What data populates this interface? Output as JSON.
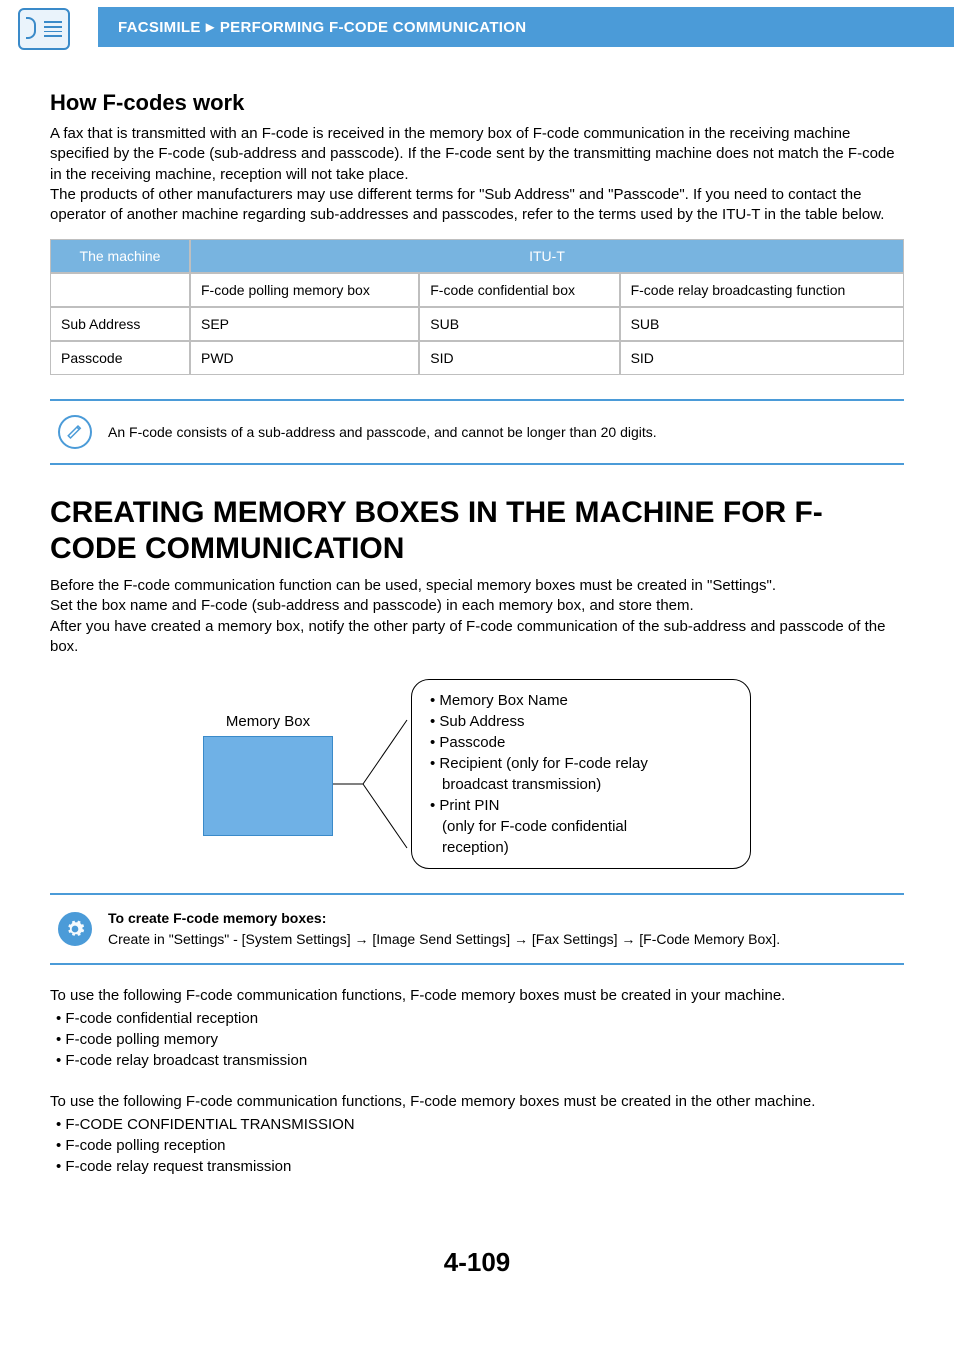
{
  "breadcrumb": {
    "section": "FACSIMILE",
    "sep": "►",
    "page": "PERFORMING F-CODE COMMUNICATION"
  },
  "subhead": "How F-codes work",
  "intro_p1": "A fax that is transmitted with an F-code is received in the memory box of F-code communication in the receiving machine specified by the F-code (sub-address and passcode). If the F-code sent by the transmitting machine does not match the F-code in the receiving machine, reception will not take place.",
  "intro_p2": "The products of other manufacturers may use different terms for \"Sub Address\" and \"Passcode\". If you need to contact the operator of another machine regarding sub-addresses and passcodes, refer to the terms used by the ITU-T in the table below.",
  "table": {
    "head_machine": "The machine",
    "head_itu": "ITU-T",
    "cols": [
      "F-code polling memory box",
      "F-code confidential box",
      "F-code relay broadcasting function"
    ],
    "rows": [
      {
        "label": "Sub Address",
        "c1": "SEP",
        "c2": "SUB",
        "c3": "SUB"
      },
      {
        "label": "Passcode",
        "c1": "PWD",
        "c2": "SID",
        "c3": "SID"
      }
    ]
  },
  "note1": "An F-code consists of a sub-address and passcode, and cannot be longer than 20 digits.",
  "mainhead": "CREATING MEMORY BOXES IN THE MACHINE FOR F-CODE COMMUNICATION",
  "main_p1": "Before the F-code communication function can be used, special memory boxes must be created in \"Settings\".",
  "main_p2": "Set the box name and F-code (sub-address and passcode) in each memory box, and store them.",
  "main_p3": "After you have created a memory box, notify the other party of F-code communication of the sub-address and passcode of the box.",
  "diagram": {
    "mem_label": "Memory Box",
    "items": [
      "Memory Box Name",
      "Sub Address",
      "Passcode",
      "Recipient (only for F-code relay",
      "broadcast transmission)",
      "Print PIN",
      "(only for F-code confidential",
      "reception)"
    ],
    "bullet_idx": [
      0,
      1,
      2,
      3,
      5
    ],
    "indent_idx": [
      4,
      6,
      7
    ]
  },
  "settings_note": {
    "title": "To create F-code memory boxes:",
    "body": "Create in \"Settings\" - [System Settings] → [Image Send Settings] → [Fax Settings] → [F-Code Memory Box]."
  },
  "funcs_your": {
    "lead": "To use the following F-code communication functions, F-code memory boxes must be created in your machine.",
    "items": [
      "F-code confidential reception",
      "F-code polling memory",
      "F-code relay broadcast transmission"
    ]
  },
  "funcs_other": {
    "lead": "To use the following F-code communication functions, F-code memory boxes must be created in the other machine.",
    "items": [
      "F-CODE CONFIDENTIAL TRANSMISSION",
      "F-code polling reception",
      "F-code relay request transmission"
    ]
  },
  "page_number": "4-109"
}
